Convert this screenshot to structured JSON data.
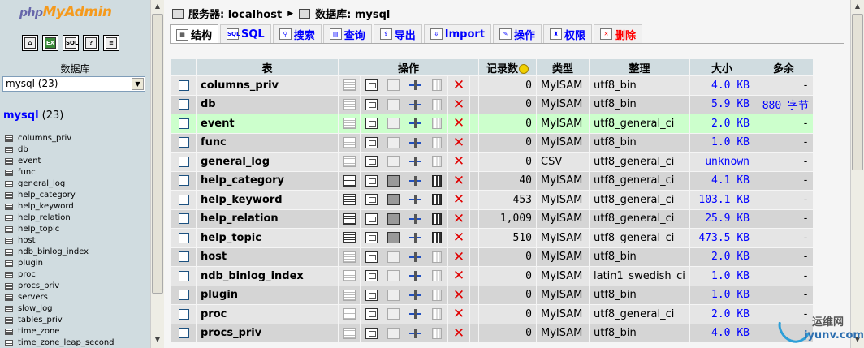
{
  "sidebar": {
    "logo_php": "php",
    "logo_pma": "MyAdmin",
    "quick_icons": [
      "home-icon",
      "exit-icon",
      "sql-icon",
      "help-icon",
      "docs-icon"
    ],
    "db_label": "数据库",
    "db_select_value": "mysql (23)",
    "db_heading": "mysql",
    "db_heading_count": "(23)",
    "tables": [
      "columns_priv",
      "db",
      "event",
      "func",
      "general_log",
      "help_category",
      "help_keyword",
      "help_relation",
      "help_topic",
      "host",
      "ndb_binlog_index",
      "plugin",
      "proc",
      "procs_priv",
      "servers",
      "slow_log",
      "tables_priv",
      "time_zone",
      "time_zone_leap_second"
    ]
  },
  "breadcrumb": {
    "server": "服务器: localhost",
    "database": "数据库: mysql"
  },
  "tabs": [
    {
      "label": "结构",
      "icon": "structure-icon",
      "state": "active"
    },
    {
      "label": "SQL",
      "icon": "sql-icon",
      "state": "normal"
    },
    {
      "label": "搜索",
      "icon": "search-icon",
      "state": "normal"
    },
    {
      "label": "查询",
      "icon": "query-icon",
      "state": "normal"
    },
    {
      "label": "导出",
      "icon": "export-icon",
      "state": "normal"
    },
    {
      "label": "Import",
      "icon": "import-icon",
      "state": "normal"
    },
    {
      "label": "操作",
      "icon": "operations-icon",
      "state": "normal"
    },
    {
      "label": "权限",
      "icon": "privileges-icon",
      "state": "normal"
    },
    {
      "label": "删除",
      "icon": "drop-icon",
      "state": "disabled"
    }
  ],
  "table": {
    "headers": {
      "table": "表",
      "actions": "操作",
      "records": "记录数",
      "type": "类型",
      "collation": "整理",
      "size": "大小",
      "overhead": "多余"
    },
    "rows": [
      {
        "name": "columns_priv",
        "records": "0",
        "type": "MyISAM",
        "collation": "utf8_bin",
        "size": "4.0 KB",
        "overhead": "-",
        "empty": true
      },
      {
        "name": "db",
        "records": "0",
        "type": "MyISAM",
        "collation": "utf8_bin",
        "size": "5.9 KB",
        "overhead": "880 字节",
        "empty": true
      },
      {
        "name": "event",
        "records": "0",
        "type": "MyISAM",
        "collation": "utf8_general_ci",
        "size": "2.0 KB",
        "overhead": "-",
        "empty": true,
        "highlight": true
      },
      {
        "name": "func",
        "records": "0",
        "type": "MyISAM",
        "collation": "utf8_bin",
        "size": "1.0 KB",
        "overhead": "-",
        "empty": true
      },
      {
        "name": "general_log",
        "records": "0",
        "type": "CSV",
        "collation": "utf8_general_ci",
        "size": "unknown",
        "overhead": "-",
        "empty": true
      },
      {
        "name": "help_category",
        "records": "40",
        "type": "MyISAM",
        "collation": "utf8_general_ci",
        "size": "4.1 KB",
        "overhead": "-",
        "empty": false
      },
      {
        "name": "help_keyword",
        "records": "453",
        "type": "MyISAM",
        "collation": "utf8_general_ci",
        "size": "103.1 KB",
        "overhead": "-",
        "empty": false
      },
      {
        "name": "help_relation",
        "records": "1,009",
        "type": "MyISAM",
        "collation": "utf8_general_ci",
        "size": "25.9 KB",
        "overhead": "-",
        "empty": false
      },
      {
        "name": "help_topic",
        "records": "510",
        "type": "MyISAM",
        "collation": "utf8_general_ci",
        "size": "473.5 KB",
        "overhead": "-",
        "empty": false
      },
      {
        "name": "host",
        "records": "0",
        "type": "MyISAM",
        "collation": "utf8_bin",
        "size": "2.0 KB",
        "overhead": "-",
        "empty": true
      },
      {
        "name": "ndb_binlog_index",
        "records": "0",
        "type": "MyISAM",
        "collation": "latin1_swedish_ci",
        "size": "1.0 KB",
        "overhead": "-",
        "empty": true
      },
      {
        "name": "plugin",
        "records": "0",
        "type": "MyISAM",
        "collation": "utf8_bin",
        "size": "1.0 KB",
        "overhead": "-",
        "empty": true
      },
      {
        "name": "proc",
        "records": "0",
        "type": "MyISAM",
        "collation": "utf8_general_ci",
        "size": "2.0 KB",
        "overhead": "-",
        "empty": true
      },
      {
        "name": "procs_priv",
        "records": "0",
        "type": "MyISAM",
        "collation": "utf8_bin",
        "size": "4.0 KB",
        "overhead": "-",
        "empty": true
      }
    ]
  },
  "watermark": {
    "cn": "运维网",
    "en": "iyunv.com"
  }
}
